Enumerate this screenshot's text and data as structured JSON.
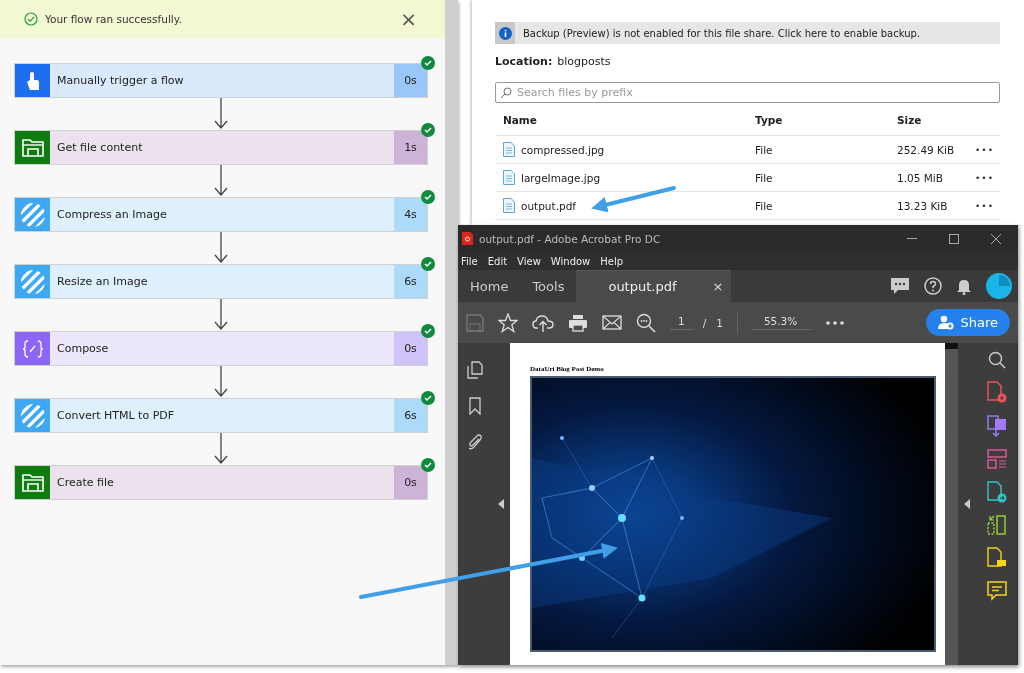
{
  "flow": {
    "banner": {
      "message": "Your flow ran successfully.",
      "close": "×"
    },
    "steps": [
      {
        "kind": "trigger",
        "title": "Manually trigger a flow",
        "duration": "0s",
        "succeeded": true
      },
      {
        "kind": "storage",
        "title": "Get file content",
        "duration": "1s",
        "succeeded": true
      },
      {
        "kind": "api",
        "title": "Compress an Image",
        "duration": "4s",
        "succeeded": true
      },
      {
        "kind": "api",
        "title": "Resize an Image",
        "duration": "6s",
        "succeeded": true
      },
      {
        "kind": "compose",
        "title": "Compose",
        "duration": "0s",
        "succeeded": true
      },
      {
        "kind": "api",
        "title": "Convert HTML to PDF",
        "duration": "6s",
        "succeeded": true
      },
      {
        "kind": "storage",
        "title": "Create file",
        "duration": "0s",
        "succeeded": true
      }
    ]
  },
  "file_share": {
    "info": "Backup (Preview) is not enabled for this file share. Click here to enable backup.",
    "location_label": "Location:",
    "location": "blogposts",
    "search": {
      "placeholder": "Search files by prefix"
    },
    "table": {
      "columns": [
        "Name",
        "Type",
        "Size"
      ],
      "rows": [
        {
          "name": "compressed.jpg",
          "type": "File",
          "size": "252.49 KiB",
          "more": "•••"
        },
        {
          "name": "largeImage.jpg",
          "type": "File",
          "size": "1.05 MiB",
          "more": "•••"
        },
        {
          "name": "output.pdf",
          "type": "File",
          "size": "13.23 KiB",
          "more": "•••"
        }
      ]
    }
  },
  "acrobat": {
    "window": {
      "title": "output.pdf - Adobe Acrobat Pro DC"
    },
    "menu": [
      "File",
      "Edit",
      "View",
      "Window",
      "Help"
    ],
    "tabs": [
      {
        "label": "Home",
        "selected": false
      },
      {
        "label": "Tools",
        "selected": false
      },
      {
        "label": "output.pdf",
        "selected": true,
        "close": "×"
      }
    ],
    "toolbar": {
      "page": "1",
      "page_sep": "/",
      "page_count": "1",
      "zoom": "55.3%",
      "share": "Share"
    },
    "document": {
      "heading": "DataUri Blog Post Demo"
    }
  }
}
